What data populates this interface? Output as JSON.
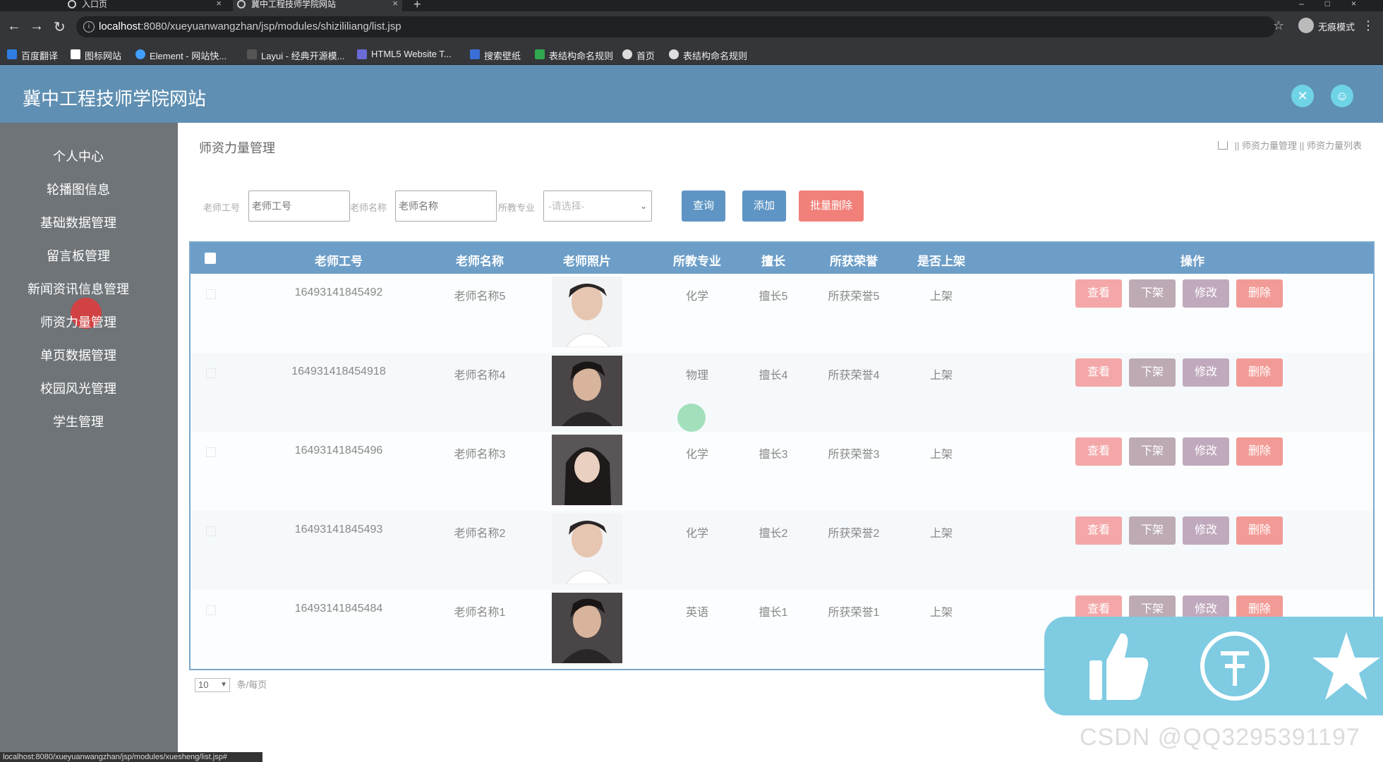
{
  "browser": {
    "tabs": [
      {
        "label": "入口页"
      },
      {
        "label": "冀中工程技师学院网站"
      }
    ],
    "url_host": "localhost",
    "url_rest": ":8080/xueyuanwangzhan/jsp/modules/shizililiang/list.jsp",
    "incognito_label": "无痕模式",
    "bookmarks": [
      "百度翻译",
      "图标网站",
      "Element - 网站快...",
      "Layui - 经典开源模...",
      "HTML5 Website T...",
      "搜索壁纸",
      "表结构命名规则",
      "首页",
      "表结构命名规则"
    ]
  },
  "app": {
    "title": "冀中工程技师学院网站",
    "header_icons": [
      "expand-icon",
      "user-icon"
    ]
  },
  "sidebar": {
    "items": [
      {
        "label": "个人中心"
      },
      {
        "label": "轮播图信息"
      },
      {
        "label": "基础数据管理"
      },
      {
        "label": "留言板管理"
      },
      {
        "label": "新闻资讯信息管理"
      },
      {
        "label": "师资力量管理"
      },
      {
        "label": "单页数据管理"
      },
      {
        "label": "校园风光管理"
      },
      {
        "label": "学生管理"
      }
    ]
  },
  "main": {
    "page_title": "师资力量管理",
    "breadcrumb": [
      "师资力量管理",
      "师资力量列表"
    ],
    "filters": {
      "teacher_no_label": "老师工号",
      "teacher_no_placeholder": "老师工号",
      "teacher_name_label": "老师名称",
      "teacher_name_placeholder": "老师名称",
      "major_label": "所教专业",
      "major_selected": "-请选择-"
    },
    "buttons": {
      "query": "查询",
      "add": "添加",
      "batch_delete": "批量删除"
    },
    "table": {
      "headers": [
        "老师工号",
        "老师名称",
        "老师照片",
        "所教专业",
        "擅长",
        "所获荣誉",
        "是否上架",
        "操作"
      ],
      "actions": {
        "view": "查看",
        "unlist": "下架",
        "edit": "修改",
        "delete": "删除"
      },
      "rows": [
        {
          "no": "16493141845492",
          "name": "老师名称5",
          "photo": "light",
          "major": "化学",
          "skill": "擅长5",
          "honor": "所获荣誉5",
          "listed": "上架"
        },
        {
          "no": "164931418454918",
          "name": "老师名称4",
          "photo": "dark",
          "major": "物理",
          "skill": "擅长4",
          "honor": "所获荣誉4",
          "listed": "上架"
        },
        {
          "no": "16493141845496",
          "name": "老师名称3",
          "photo": "dark",
          "major": "化学",
          "skill": "擅长3",
          "honor": "所获荣誉3",
          "listed": "上架"
        },
        {
          "no": "16493141845493",
          "name": "老师名称2",
          "photo": "light",
          "major": "化学",
          "skill": "擅长2",
          "honor": "所获荣誉2",
          "listed": "上架"
        },
        {
          "no": "16493141845484",
          "name": "老师名称1",
          "photo": "dark",
          "major": "英语",
          "skill": "擅长1",
          "honor": "所获荣誉1",
          "listed": "上架"
        }
      ]
    },
    "pager": {
      "page_size": "10",
      "suffix": "条/每页"
    }
  },
  "overlay": {
    "watermark": "CSDN @QQ3295391197",
    "status_url": "localhost:8080/xueyuanwangzhan/jsp/modules/xuesheng/list.jsp#",
    "icons": [
      "thumbs-up-icon",
      "coin-icon",
      "star-icon"
    ]
  },
  "colors": {
    "header": "#5f8fb2",
    "sidebar": "#6f7478",
    "table_header": "#6d9ec8",
    "primary_button": "#5e95c4",
    "danger_button": "#f08079"
  }
}
